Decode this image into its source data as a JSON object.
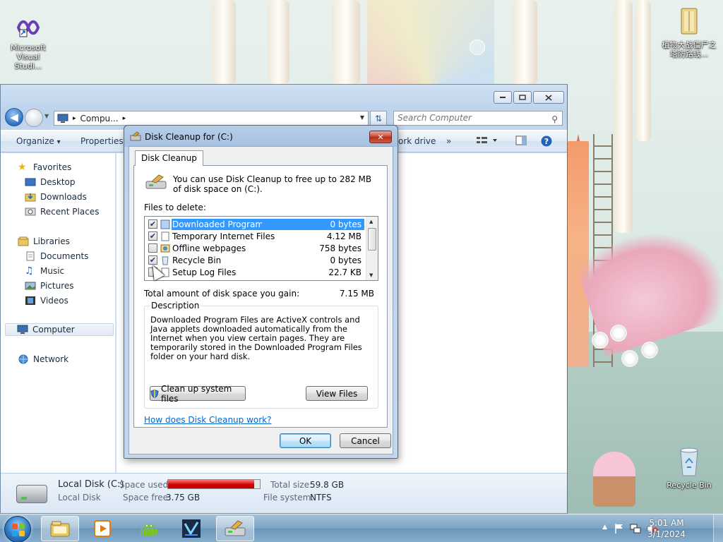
{
  "desktop": {
    "icons": [
      {
        "label": "Microsoft Visual Studi...",
        "icon": "visual-studio-icon"
      },
      {
        "label": "植物大战僵尸之塔防路线...",
        "icon": "folder-icon"
      },
      {
        "label": "Recycle Bin",
        "icon": "recycle-bin-icon"
      }
    ]
  },
  "explorer": {
    "address": {
      "path": "Compu...",
      "separator": "▸"
    },
    "search": {
      "placeholder": "Search Computer"
    },
    "toolbar": {
      "organize": "Organize",
      "organize_arrow": "▾",
      "properties": "Properties",
      "map_drive": "ork drive",
      "more": "»"
    },
    "sidebar": {
      "favorites": "Favorites",
      "favorites_items": [
        "Desktop",
        "Downloads",
        "Recent Places"
      ],
      "libraries": "Libraries",
      "libraries_items": [
        "Documents",
        "Music",
        "Pictures",
        "Videos"
      ],
      "computer": "Computer",
      "network": "Network"
    },
    "details": {
      "name": "Local Disk (C:)",
      "type": "Local Disk",
      "space_used_label": "Space used:",
      "space_free_label": "Space free:",
      "space_free": "3.75 GB",
      "total_size_label": "Total size:",
      "total_size": "59.8 GB",
      "file_system_label": "File system:",
      "file_system": "NTFS",
      "used_fraction": 0.94,
      "bar_color": "#d00000"
    }
  },
  "dialog": {
    "title": "Disk Cleanup for  (C:)",
    "tab": "Disk Cleanup",
    "info": "You can use Disk Cleanup to free up to 282 MB of disk space on  (C:).",
    "files_label": "Files to delete:",
    "files": [
      {
        "name": "Downloaded Program Files",
        "size": "0 bytes",
        "checked": true,
        "selected": true
      },
      {
        "name": "Temporary Internet Files",
        "size": "4.12 MB",
        "checked": true,
        "selected": false
      },
      {
        "name": "Offline webpages",
        "size": "758 bytes",
        "checked": false,
        "selected": false
      },
      {
        "name": "Recycle Bin",
        "size": "0 bytes",
        "checked": true,
        "selected": false
      },
      {
        "name": "Setup Log Files",
        "size": "22.7 KB",
        "checked": false,
        "selected": false
      }
    ],
    "total_label": "Total amount of disk space you gain:",
    "total_value": "7.15 MB",
    "description_legend": "Description",
    "description": "Downloaded Program Files are ActiveX controls and Java applets downloaded automatically from the Internet when you view certain pages. They are temporarily stored in the Downloaded Program Files folder on your hard disk.",
    "cleanup_system_button": "Clean up system files",
    "view_files_button": "View Files",
    "help_link": "How does Disk Cleanup work?",
    "ok_button": "OK",
    "cancel_button": "Cancel",
    "close_glyph": "✕"
  },
  "taskbar": {
    "time": "5:01 AM",
    "date": "3/1/2024"
  }
}
